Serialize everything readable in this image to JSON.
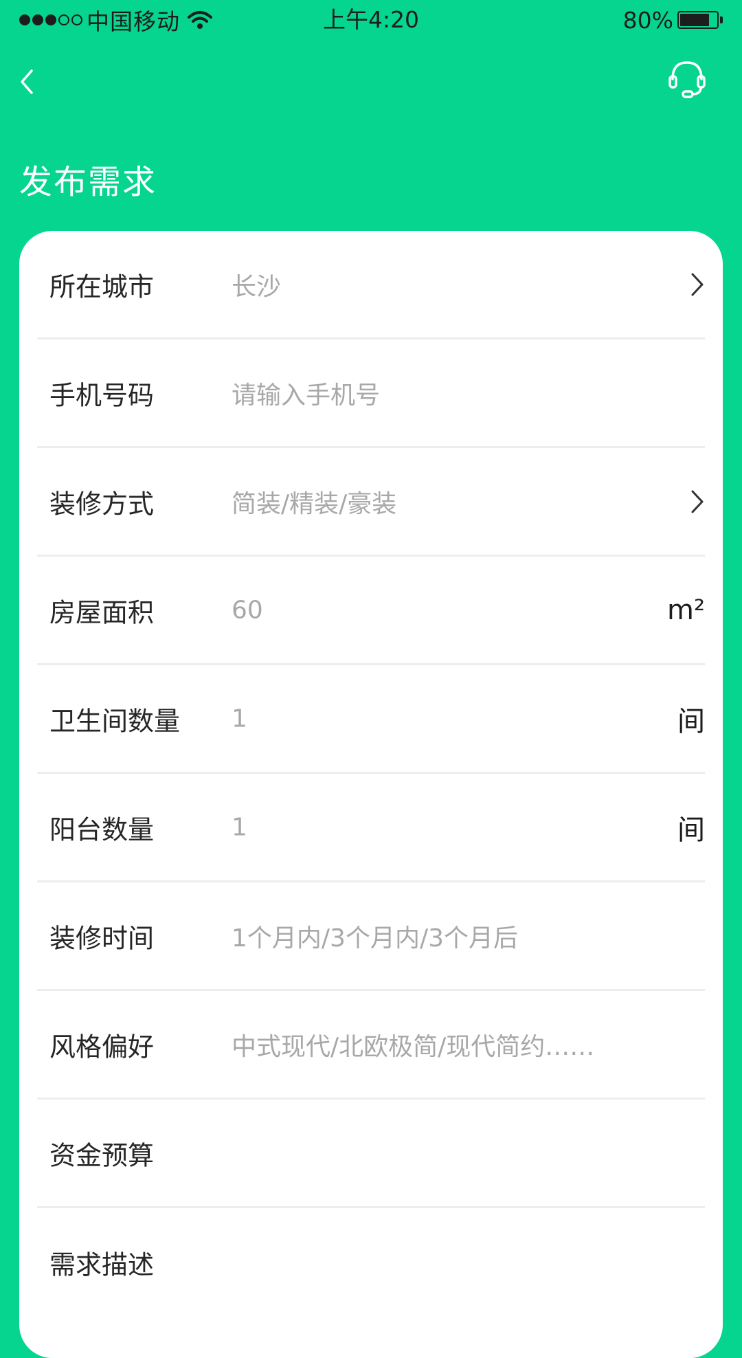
{
  "status_bar": {
    "carrier": "中国移动",
    "time": "上午4:20",
    "battery_percent": "80%",
    "battery_level": 0.8,
    "signal_bars_filled": 3,
    "signal_bars_total": 5
  },
  "nav": {
    "back_icon": "chevron-left-icon",
    "service_icon": "headset-icon"
  },
  "page": {
    "title": "发布需求"
  },
  "form": {
    "rows": [
      {
        "label": "所在城市",
        "value": "长沙",
        "accessory": "chevron-right"
      },
      {
        "label": "手机号码",
        "value": "请输入手机号",
        "accessory": ""
      },
      {
        "label": "装修方式",
        "value": "简装/精装/豪装",
        "accessory": "chevron-right"
      },
      {
        "label": "房屋面积",
        "value": "60",
        "unit": "m²"
      },
      {
        "label": "卫生间数量",
        "value": "1",
        "unit": "间"
      },
      {
        "label": "阳台数量",
        "value": "1",
        "unit": "间"
      },
      {
        "label": "装修时间",
        "value": "1个月内/3个月内/3个月后"
      },
      {
        "label": "风格偏好",
        "value": "中式现代/北欧极简/现代简约……"
      },
      {
        "label": "资金预算",
        "value": ""
      },
      {
        "label": "需求描述",
        "value": ""
      }
    ]
  },
  "colors": {
    "brand_green": "#05D58E",
    "card_bg": "#ffffff",
    "label_text": "#262626",
    "placeholder_text": "#a8a8a8",
    "divider": "#ededed"
  }
}
